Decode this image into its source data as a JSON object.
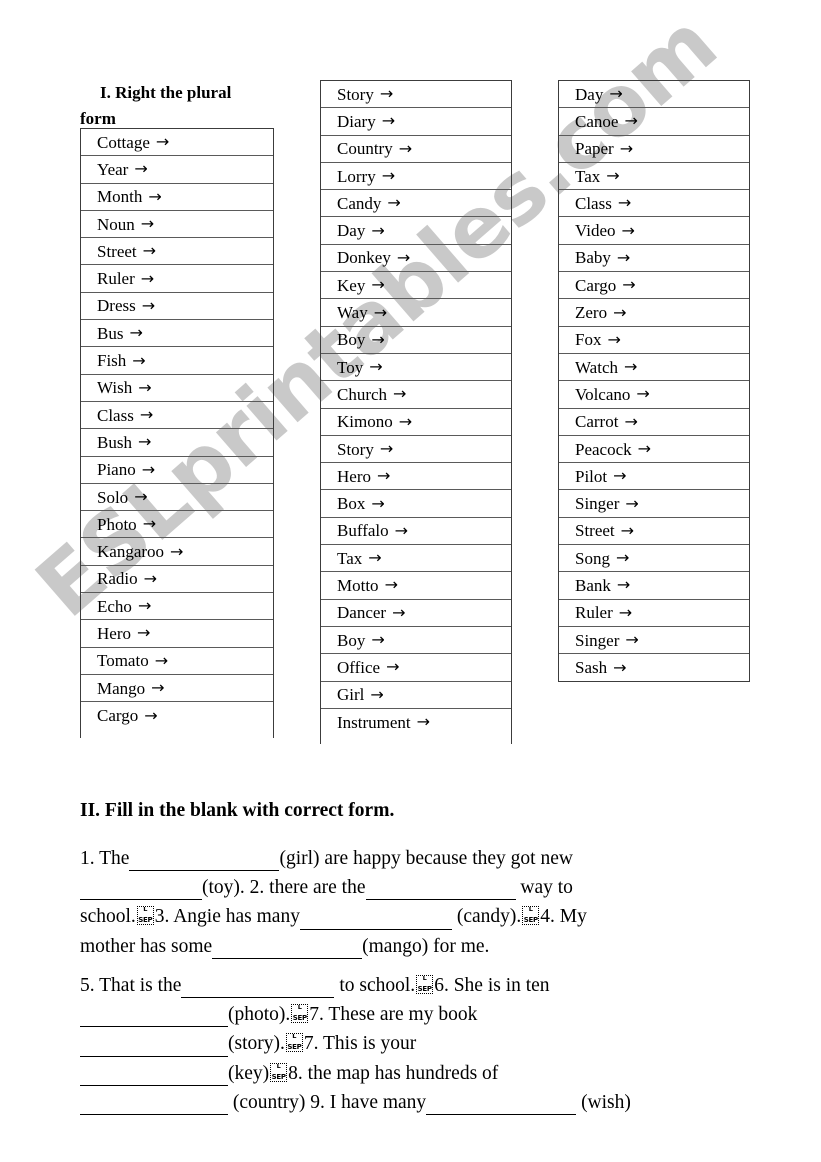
{
  "section1": {
    "heading_line1": "I. Right the plural",
    "heading_line2": "form",
    "arrow": "→",
    "column1": [
      "Cottage",
      "Year",
      "Month",
      "Noun",
      "Street",
      "Ruler",
      "Dress",
      "Bus",
      "Fish",
      "Wish",
      "Class",
      "Bush",
      "Piano",
      "Solo",
      "Photo",
      "Kangaroo",
      "Radio",
      "Echo",
      "Hero",
      "Tomato",
      "Mango",
      "Cargo"
    ],
    "column2": [
      "Story",
      "Diary",
      "Country",
      "Lorry",
      "Candy",
      "Day",
      "Donkey",
      "Key",
      "Way",
      "Boy",
      "Toy",
      "Church",
      "Kimono",
      "Story",
      "Hero",
      "Box",
      "Buffalo",
      "Tax",
      "Motto",
      "Dancer",
      "Boy",
      "Office",
      "Girl",
      "Instrument"
    ],
    "column3": [
      "Day",
      "Canoe",
      "Paper",
      "Tax",
      "Class",
      "Video",
      "Baby",
      "Cargo",
      "Zero",
      "Fox",
      "Watch",
      "Volcano",
      "Carrot",
      "Peacock",
      "Pilot",
      "Singer",
      "Street",
      "Song",
      "Bank",
      "Ruler",
      "Singer",
      "Sash"
    ]
  },
  "section2": {
    "heading": "II. Fill in the blank with correct form.",
    "separator_glyph": {
      "top": "L",
      "bottom": "SEP"
    },
    "paragraph1": [
      {
        "type": "text",
        "value": "1. The"
      },
      {
        "type": "blank",
        "width": 150
      },
      {
        "type": "text",
        "value": "(girl) are happy because they got new"
      },
      {
        "type": "break"
      },
      {
        "type": "blank",
        "width": 122
      },
      {
        "type": "text",
        "value": "(toy). 2. there are the"
      },
      {
        "type": "blank",
        "width": 150
      },
      {
        "type": "text",
        "value": " way to"
      },
      {
        "type": "break"
      },
      {
        "type": "text",
        "value": "school."
      },
      {
        "type": "sep"
      },
      {
        "type": "text",
        "value": "3. Angie has many"
      },
      {
        "type": "blank",
        "width": 152
      },
      {
        "type": "text",
        "value": " (candy)."
      },
      {
        "type": "sep"
      },
      {
        "type": "text",
        "value": "4. My"
      },
      {
        "type": "break"
      },
      {
        "type": "text",
        "value": "mother has some"
      },
      {
        "type": "blank",
        "width": 150
      },
      {
        "type": "text",
        "value": "(mango) for me."
      }
    ],
    "paragraph2": [
      {
        "type": "text",
        "value": "5. That is the"
      },
      {
        "type": "blank",
        "width": 153
      },
      {
        "type": "text",
        "value": " to school."
      },
      {
        "type": "sep"
      },
      {
        "type": "text",
        "value": "6. She is in ten"
      },
      {
        "type": "break"
      },
      {
        "type": "blank",
        "width": 148
      },
      {
        "type": "text",
        "value": "(photo)."
      },
      {
        "type": "sep"
      },
      {
        "type": "text",
        "value": "7. These are my book"
      },
      {
        "type": "break"
      },
      {
        "type": "blank",
        "width": 148
      },
      {
        "type": "text",
        "value": "(story)."
      },
      {
        "type": "sep"
      },
      {
        "type": "text",
        "value": "7. This is your"
      },
      {
        "type": "break"
      },
      {
        "type": "blank",
        "width": 148
      },
      {
        "type": "text",
        "value": "(key)"
      },
      {
        "type": "sep"
      },
      {
        "type": "text",
        "value": "8. the map has hundreds of"
      },
      {
        "type": "break"
      },
      {
        "type": "blank",
        "width": 148
      },
      {
        "type": "text",
        "value": " (country) 9. I have many"
      },
      {
        "type": "blank",
        "width": 150
      },
      {
        "type": "text",
        "value": " (wish)"
      }
    ]
  },
  "watermark": {
    "text": "ESLprintables.com",
    "color": "#c9c9c9"
  }
}
